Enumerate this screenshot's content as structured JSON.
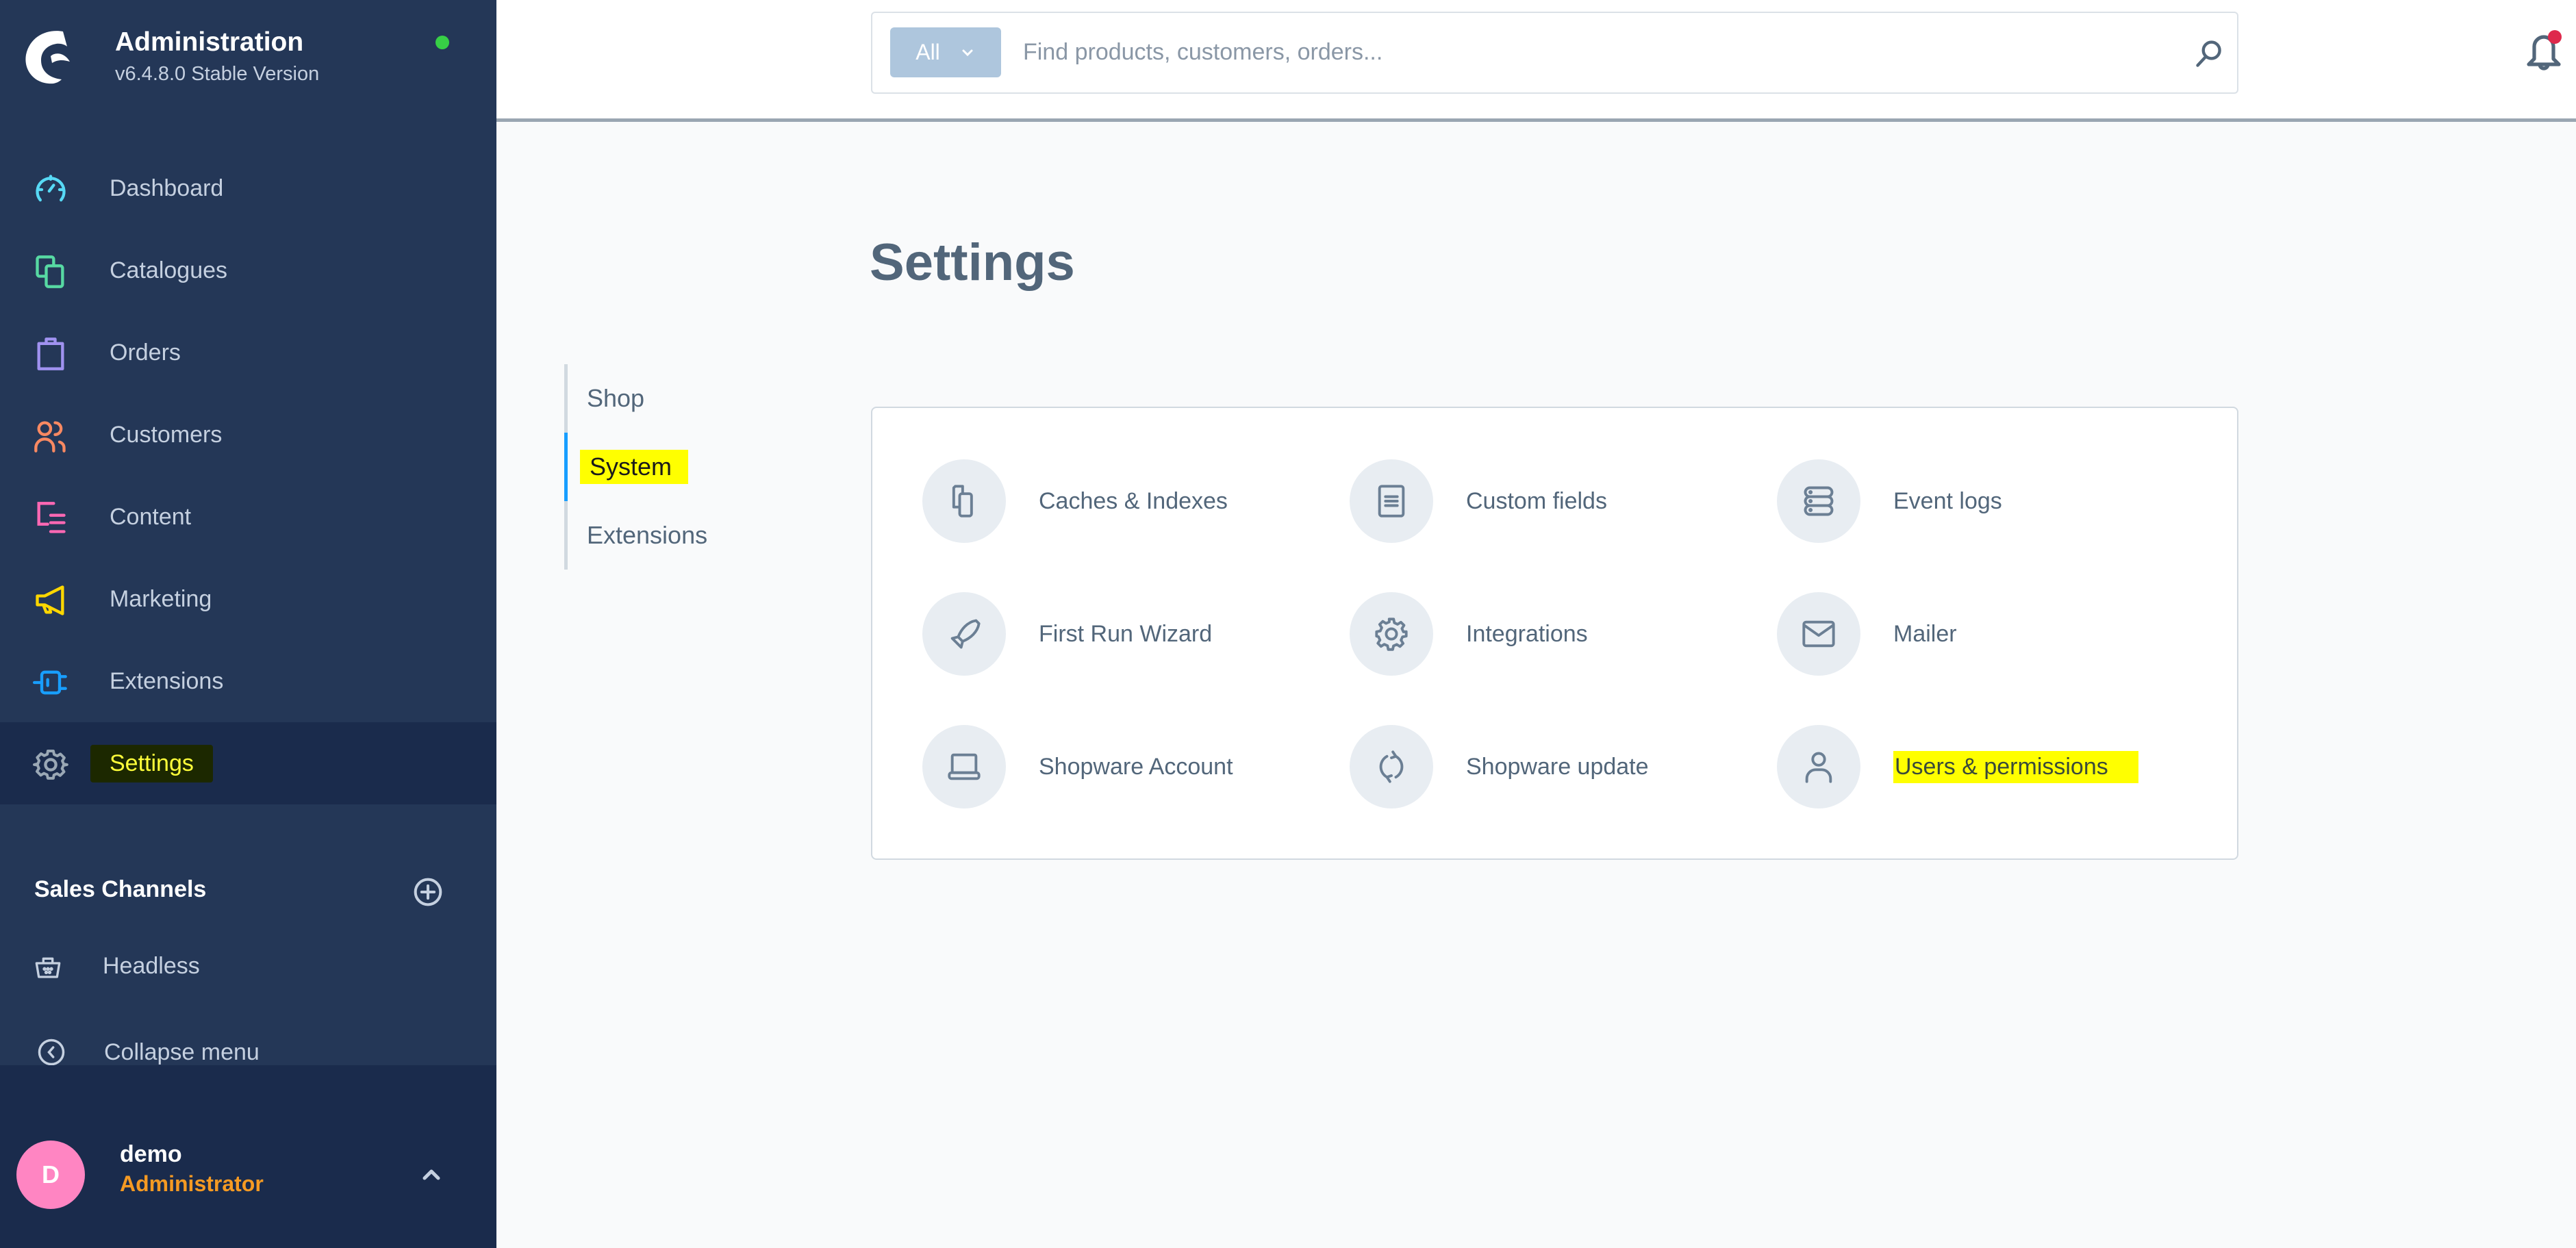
{
  "brand": {
    "title": "Administration",
    "version": "v6.4.8.0 Stable Version",
    "status_color": "#37d046"
  },
  "sidebar": {
    "items": [
      {
        "label": "Dashboard",
        "icon": "dashboard-icon",
        "color": "#57d9f5"
      },
      {
        "label": "Catalogues",
        "icon": "catalogues-icon",
        "color": "#57d9a3"
      },
      {
        "label": "Orders",
        "icon": "orders-icon",
        "color": "#a092f0"
      },
      {
        "label": "Customers",
        "icon": "customers-icon",
        "color": "#f88962"
      },
      {
        "label": "Content",
        "icon": "content-icon",
        "color": "#ff68b4"
      },
      {
        "label": "Marketing",
        "icon": "marketing-icon",
        "color": "#ffd700"
      },
      {
        "label": "Extensions",
        "icon": "extensions-icon",
        "color": "#189eff"
      },
      {
        "label": "Settings",
        "icon": "settings-icon",
        "color": "#9aa8b5",
        "active": true
      }
    ],
    "sales_channels_label": "Sales Channels",
    "channels": [
      {
        "label": "Headless",
        "icon": "basket-icon"
      }
    ],
    "collapse_label": "Collapse menu"
  },
  "user": {
    "initial": "D",
    "name": "demo",
    "role": "Administrator",
    "avatar_color": "#ff85c2",
    "role_color": "#f59a23"
  },
  "header": {
    "search_type": "All",
    "search_placeholder": "Find products, customers, orders...",
    "search_value": "",
    "notification_badge_color": "#de294c"
  },
  "main": {
    "title": "Settings",
    "tabs": [
      {
        "label": "Shop",
        "active": false
      },
      {
        "label": "System",
        "active": true
      },
      {
        "label": "Extensions",
        "active": false
      }
    ],
    "items": [
      {
        "label": "Caches & Indexes",
        "icon": "caches-icon"
      },
      {
        "label": "Custom fields",
        "icon": "custom-fields-icon"
      },
      {
        "label": "Event logs",
        "icon": "event-logs-icon"
      },
      {
        "label": "First Run Wizard",
        "icon": "rocket-icon"
      },
      {
        "label": "Integrations",
        "icon": "gear-icon"
      },
      {
        "label": "Mailer",
        "icon": "mail-icon"
      },
      {
        "label": "Shopware Account",
        "icon": "laptop-icon"
      },
      {
        "label": "Shopware update",
        "icon": "refresh-icon"
      },
      {
        "label": "Users & permissions",
        "icon": "user-icon",
        "highlighted": true
      }
    ]
  }
}
